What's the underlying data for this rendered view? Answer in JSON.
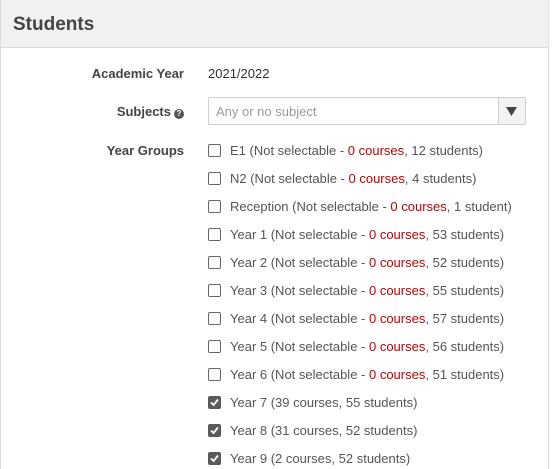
{
  "header": {
    "title": "Students"
  },
  "fields": {
    "academic_year": {
      "label": "Academic Year",
      "value": "2021/2022"
    },
    "subjects": {
      "label": "Subjects",
      "placeholder": "Any or no subject",
      "help_icon": "question-circle-icon"
    },
    "year_groups": {
      "label": "Year Groups"
    }
  },
  "colors": {
    "course_count_red": "#c00000",
    "checkbox_checked": "#5a5a5a"
  },
  "year_groups": [
    {
      "name": "E1",
      "checked": false,
      "selectable": false,
      "prefix": "E1 (Not selectable - ",
      "courses": "0 courses",
      "suffix": ", 12 students)"
    },
    {
      "name": "N2",
      "checked": false,
      "selectable": false,
      "prefix": "N2 (Not selectable - ",
      "courses": "0 courses",
      "suffix": ", 4 students)"
    },
    {
      "name": "Reception",
      "checked": false,
      "selectable": false,
      "prefix": "Reception (Not selectable - ",
      "courses": "0 courses",
      "suffix": ", 1 student)"
    },
    {
      "name": "Year 1",
      "checked": false,
      "selectable": false,
      "prefix": "Year 1 (Not selectable - ",
      "courses": "0 courses",
      "suffix": ", 53 students)"
    },
    {
      "name": "Year 2",
      "checked": false,
      "selectable": false,
      "prefix": "Year 2 (Not selectable - ",
      "courses": "0 courses",
      "suffix": ", 52 students)"
    },
    {
      "name": "Year 3",
      "checked": false,
      "selectable": false,
      "prefix": "Year 3 (Not selectable - ",
      "courses": "0 courses",
      "suffix": ", 55 students)"
    },
    {
      "name": "Year 4",
      "checked": false,
      "selectable": false,
      "prefix": "Year 4 (Not selectable - ",
      "courses": "0 courses",
      "suffix": ", 57 students)"
    },
    {
      "name": "Year 5",
      "checked": false,
      "selectable": false,
      "prefix": "Year 5 (Not selectable - ",
      "courses": "0 courses",
      "suffix": ", 56 students)"
    },
    {
      "name": "Year 6",
      "checked": false,
      "selectable": false,
      "prefix": "Year 6 (Not selectable - ",
      "courses": "0 courses",
      "suffix": ", 51 students)"
    },
    {
      "name": "Year 7",
      "checked": true,
      "selectable": true,
      "prefix": "Year 7 (39 courses, 55 students)",
      "courses": "",
      "suffix": ""
    },
    {
      "name": "Year 8",
      "checked": true,
      "selectable": true,
      "prefix": "Year 8 (31 courses, 52 students)",
      "courses": "",
      "suffix": ""
    },
    {
      "name": "Year 9",
      "checked": true,
      "selectable": true,
      "prefix": "Year 9 (2 courses, 52 students)",
      "courses": "",
      "suffix": ""
    }
  ]
}
